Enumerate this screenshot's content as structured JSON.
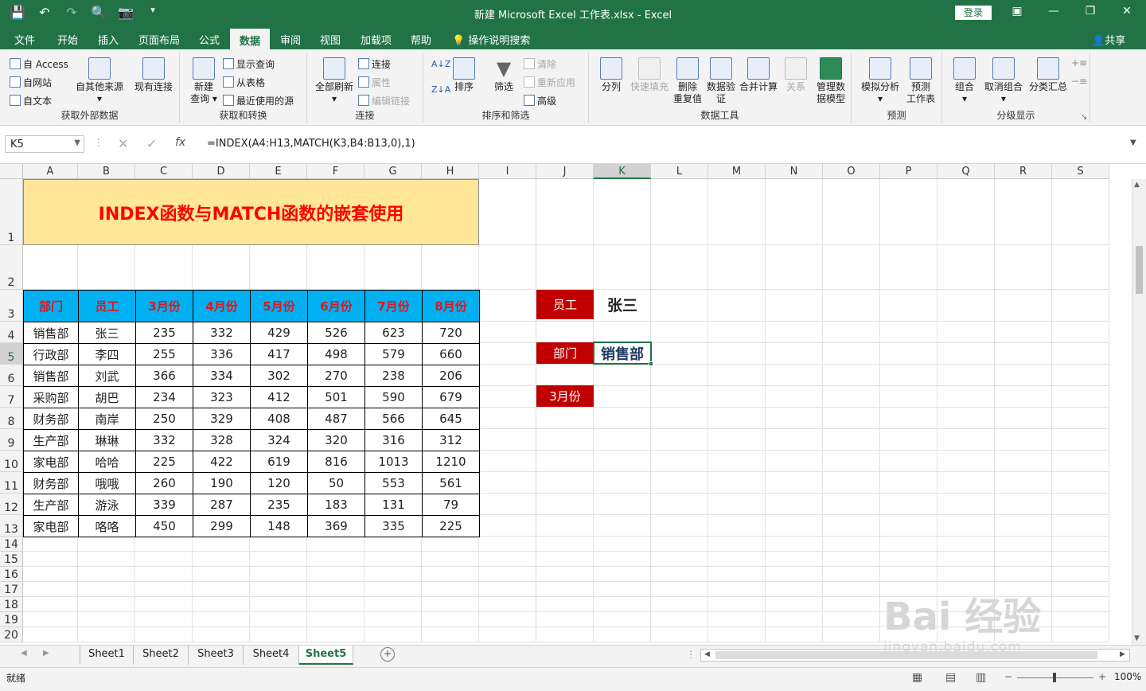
{
  "window": {
    "title": "新建 Microsoft Excel 工作表.xlsx  -  Excel",
    "login": "登录",
    "share": "共享"
  },
  "tabs": [
    "文件",
    "开始",
    "插入",
    "页面布局",
    "公式",
    "数据",
    "审阅",
    "视图",
    "加载项",
    "帮助",
    "操作说明搜索"
  ],
  "active_tab": "数据",
  "ribbon": {
    "g1": {
      "label": "获取外部数据",
      "items": [
        "自 Access",
        "自网站",
        "自文本"
      ],
      "big": [
        "自其他来源"
      ],
      "big2": "现有连接"
    },
    "g2": {
      "label": "获取和转换",
      "big": [
        "新建",
        "查询"
      ],
      "items": [
        "显示查询",
        "从表格",
        "最近使用的源"
      ]
    },
    "g3": {
      "label": "连接",
      "big": "全部刷新",
      "items": [
        "连接",
        "属性",
        "编辑链接"
      ]
    },
    "g4": {
      "label": "排序和筛选",
      "sort": "排序",
      "filter": "筛选",
      "items": [
        "清除",
        "重新应用",
        "高级"
      ]
    },
    "g5": {
      "label": "数据工具",
      "big": [
        "分列",
        "快速填充",
        "删除\n重复值",
        "数据验\n证",
        "合并计算",
        "关系",
        "管理数\n据模型"
      ]
    },
    "g6": {
      "label": "预测",
      "big": [
        "模拟分析",
        "预测\n工作表"
      ]
    },
    "g7": {
      "label": "分级显示",
      "big": [
        "组合",
        "取消组合",
        "分类汇总"
      ]
    }
  },
  "formula_bar": {
    "name_box": "K5",
    "formula": "=INDEX(A4:H13,MATCH(K3,B4:B13,0),1)"
  },
  "columns": [
    "A",
    "B",
    "C",
    "D",
    "E",
    "F",
    "G",
    "H",
    "I",
    "J",
    "K",
    "L",
    "M",
    "N",
    "O",
    "P",
    "Q",
    "R",
    "S"
  ],
  "rows": [
    "1",
    "2",
    "3",
    "4",
    "5",
    "6",
    "7",
    "8",
    "9",
    "10",
    "11",
    "12",
    "13",
    "14",
    "15",
    "16",
    "17",
    "18",
    "19",
    "20"
  ],
  "sheet_title": "INDEX函数与MATCH函数的嵌套使用",
  "table": {
    "headers": [
      "部门",
      "员工",
      "3月份",
      "4月份",
      "5月份",
      "6月份",
      "7月份",
      "8月份"
    ],
    "rows": [
      [
        "销售部",
        "张三",
        "235",
        "332",
        "429",
        "526",
        "623",
        "720"
      ],
      [
        "行政部",
        "李四",
        "255",
        "336",
        "417",
        "498",
        "579",
        "660"
      ],
      [
        "销售部",
        "刘武",
        "366",
        "334",
        "302",
        "270",
        "238",
        "206"
      ],
      [
        "采购部",
        "胡巴",
        "234",
        "323",
        "412",
        "501",
        "590",
        "679"
      ],
      [
        "财务部",
        "南岸",
        "250",
        "329",
        "408",
        "487",
        "566",
        "645"
      ],
      [
        "生产部",
        "琳琳",
        "332",
        "328",
        "324",
        "320",
        "316",
        "312"
      ],
      [
        "家电部",
        "哈哈",
        "225",
        "422",
        "619",
        "816",
        "1013",
        "1210"
      ],
      [
        "财务部",
        "哦哦",
        "260",
        "190",
        "120",
        "50",
        "553",
        "561"
      ],
      [
        "生产部",
        "游泳",
        "339",
        "287",
        "235",
        "183",
        "131",
        "79"
      ],
      [
        "家电部",
        "咯咯",
        "450",
        "299",
        "148",
        "369",
        "335",
        "225"
      ]
    ]
  },
  "lookup": {
    "emp_label": "员工",
    "emp_value": "张三",
    "dept_label": "部门",
    "dept_value": "销售部",
    "month_label": "3月份"
  },
  "sheets": [
    "Sheet1",
    "Sheet2",
    "Sheet3",
    "Sheet4",
    "Sheet5"
  ],
  "active_sheet": "Sheet5",
  "status": {
    "ready": "就绪",
    "zoom": "100%"
  },
  "watermark": {
    "main": "Bai 经验",
    "sub": "jingyan.baidu.com"
  },
  "colors": {
    "excel_green": "#217346",
    "header_blue": "#00b0f0",
    "header_text": "#e4141b",
    "label_red": "#c00000",
    "title_fill": "#ffe699"
  }
}
